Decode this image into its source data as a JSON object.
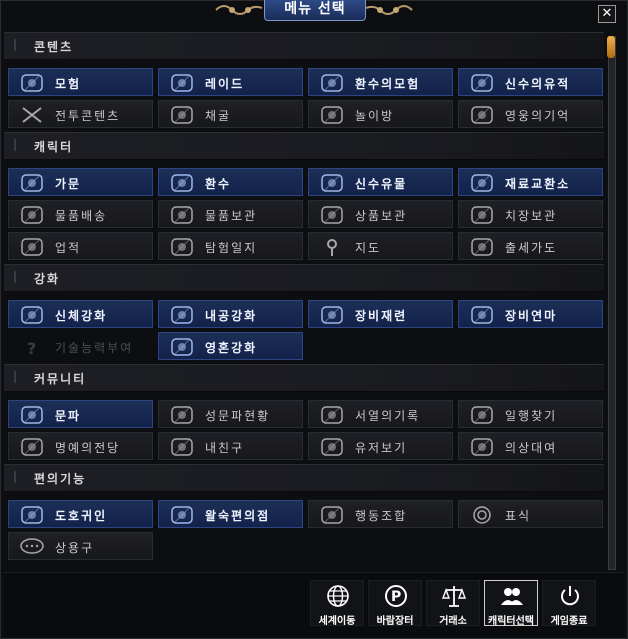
{
  "window": {
    "title": "메뉴 선택",
    "close_glyph": "✕"
  },
  "sections": [
    {
      "label": "콘텐츠",
      "items": [
        {
          "label": "모험",
          "icon": "adventure-icon",
          "highlight": true
        },
        {
          "label": "레이드",
          "icon": "raid-icon",
          "highlight": true
        },
        {
          "label": "환수의모험",
          "icon": "spirit-adventure-icon",
          "highlight": true
        },
        {
          "label": "신수의유적",
          "icon": "divine-ruins-icon",
          "highlight": true
        },
        {
          "label": "전투콘텐츠",
          "icon": "crossed-swords-icon",
          "highlight": false
        },
        {
          "label": "채굴",
          "icon": "mining-icon",
          "highlight": false
        },
        {
          "label": "놀이방",
          "icon": "playroom-icon",
          "highlight": false
        },
        {
          "label": "영웅의기억",
          "icon": "hero-memory-icon",
          "highlight": false
        }
      ]
    },
    {
      "label": "캐릭터",
      "items": [
        {
          "label": "가문",
          "icon": "clan-icon",
          "highlight": true
        },
        {
          "label": "환수",
          "icon": "spirit-beast-icon",
          "highlight": true
        },
        {
          "label": "신수유물",
          "icon": "divine-relic-icon",
          "highlight": true
        },
        {
          "label": "재료교환소",
          "icon": "material-exchange-icon",
          "highlight": true
        },
        {
          "label": "물품배송",
          "icon": "delivery-icon",
          "highlight": false
        },
        {
          "label": "물품보관",
          "icon": "storage-icon",
          "highlight": false
        },
        {
          "label": "상품보관",
          "icon": "goods-storage-icon",
          "highlight": false
        },
        {
          "label": "치장보관",
          "icon": "costume-storage-icon",
          "highlight": false
        },
        {
          "label": "업적",
          "icon": "achievement-icon",
          "highlight": false
        },
        {
          "label": "탐험일지",
          "icon": "exploration-log-icon",
          "highlight": false
        },
        {
          "label": "지도",
          "icon": "map-pin-icon",
          "highlight": false
        },
        {
          "label": "출세가도",
          "icon": "career-path-icon",
          "highlight": false
        }
      ]
    },
    {
      "label": "강화",
      "items": [
        {
          "label": "신체강화",
          "icon": "body-enhance-icon",
          "highlight": true
        },
        {
          "label": "내공강화",
          "icon": "inner-power-icon",
          "highlight": true
        },
        {
          "label": "장비재련",
          "icon": "equipment-refine-icon",
          "highlight": true
        },
        {
          "label": "장비연마",
          "icon": "equipment-polish-icon",
          "highlight": true
        },
        {
          "label": "기술능력부여",
          "icon": "question-icon",
          "highlight": false,
          "disabled": true
        },
        {
          "label": "영혼강화",
          "icon": "soul-enhance-icon",
          "highlight": true
        }
      ]
    },
    {
      "label": "커뮤니티",
      "items": [
        {
          "label": "문파",
          "icon": "guild-icon",
          "highlight": true
        },
        {
          "label": "성문파현황",
          "icon": "castle-status-icon",
          "highlight": false
        },
        {
          "label": "서열의기록",
          "icon": "ranking-icon",
          "highlight": false
        },
        {
          "label": "일행찾기",
          "icon": "party-search-icon",
          "highlight": false
        },
        {
          "label": "명예의전당",
          "icon": "hall-of-fame-icon",
          "highlight": false
        },
        {
          "label": "내친구",
          "icon": "friends-icon",
          "highlight": false
        },
        {
          "label": "유저보기",
          "icon": "user-search-icon",
          "highlight": false
        },
        {
          "label": "의상대여",
          "icon": "costume-rental-icon",
          "highlight": false
        }
      ]
    },
    {
      "label": "편의기능",
      "items": [
        {
          "label": "도호귀인",
          "icon": "noble-icon",
          "highlight": true
        },
        {
          "label": "왈숙편의점",
          "icon": "store-icon",
          "highlight": true
        },
        {
          "label": "행동조합",
          "icon": "action-combo-icon",
          "highlight": false
        },
        {
          "label": "표식",
          "icon": "marker-icon",
          "highlight": false
        },
        {
          "label": "상용구",
          "icon": "chat-bubble-icon",
          "highlight": false
        }
      ]
    }
  ],
  "bottom_bar": [
    {
      "label": "세계이동",
      "icon": "globe-icon"
    },
    {
      "label": "바람장터",
      "icon": "p-coin-icon"
    },
    {
      "label": "거래소",
      "icon": "scales-icon"
    },
    {
      "label": "캐릭터선택",
      "icon": "characters-icon",
      "active": true
    },
    {
      "label": "게임종료",
      "icon": "power-icon"
    }
  ],
  "colors": {
    "highlight_bg": "#1c2f57",
    "normal_bg": "#1f2025",
    "accent": "#f0b24a"
  }
}
